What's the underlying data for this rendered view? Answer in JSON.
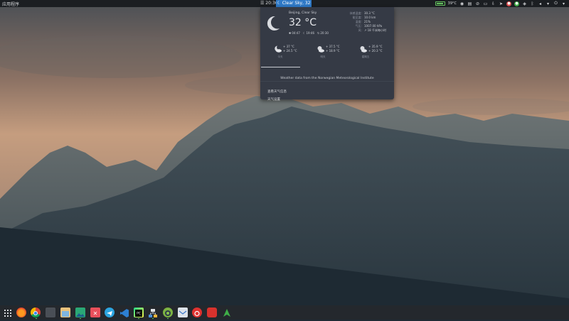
{
  "topbar": {
    "apps_label": "应用程序",
    "clock": "☰ 20:36",
    "weather_indicator": "☾ Clear Sky, 32 °C",
    "tray_temp": "39°C"
  },
  "weather": {
    "location": "Beijing, Clear Sky",
    "temperature": "32 °C",
    "sunrise": "04:47",
    "sunset": "19:46",
    "build": "20:30",
    "details": [
      {
        "key": "体感温度:",
        "value": "30.3 °C"
      },
      {
        "key": "能见度:",
        "value": "10.0 km"
      },
      {
        "key": "湿度:",
        "value": "21%"
      },
      {
        "key": "气压:",
        "value": "1007.00 hPa"
      },
      {
        "key": "风:",
        "value": "↗ 18 千米每小时"
      }
    ],
    "forecast": [
      {
        "day": "今天",
        "high": "+ 37 °C",
        "low": "+ 24.5 °C"
      },
      {
        "day": "明天",
        "high": "+ 37.5 °C",
        "low": "+ 18.9 °C"
      },
      {
        "day": "星期五",
        "high": "+ 35.9 °C",
        "low": "+ 20.3 °C"
      }
    ],
    "credit": "Weather data from the Norwegian Meteorological Institute",
    "menu": {
      "forecast": "查看天气信息",
      "settings": "天气设置"
    }
  },
  "colors": {
    "accent": "#2f79c7",
    "popup_bg": "#353a45",
    "topbar_bg": "#1b1e22"
  },
  "dock": {
    "items": [
      "app-grid-icon",
      "firefox-icon",
      "chrome-icon",
      "terminal-icon",
      "files-icon",
      "image-viewer-icon",
      "xmind-icon",
      "telegram-icon",
      "vscode-icon",
      "pycharm-icon",
      "network-icon",
      "android-studio-icon",
      "mail-icon",
      "netease-music-icon",
      "red-app-icon",
      "android-icon"
    ]
  }
}
